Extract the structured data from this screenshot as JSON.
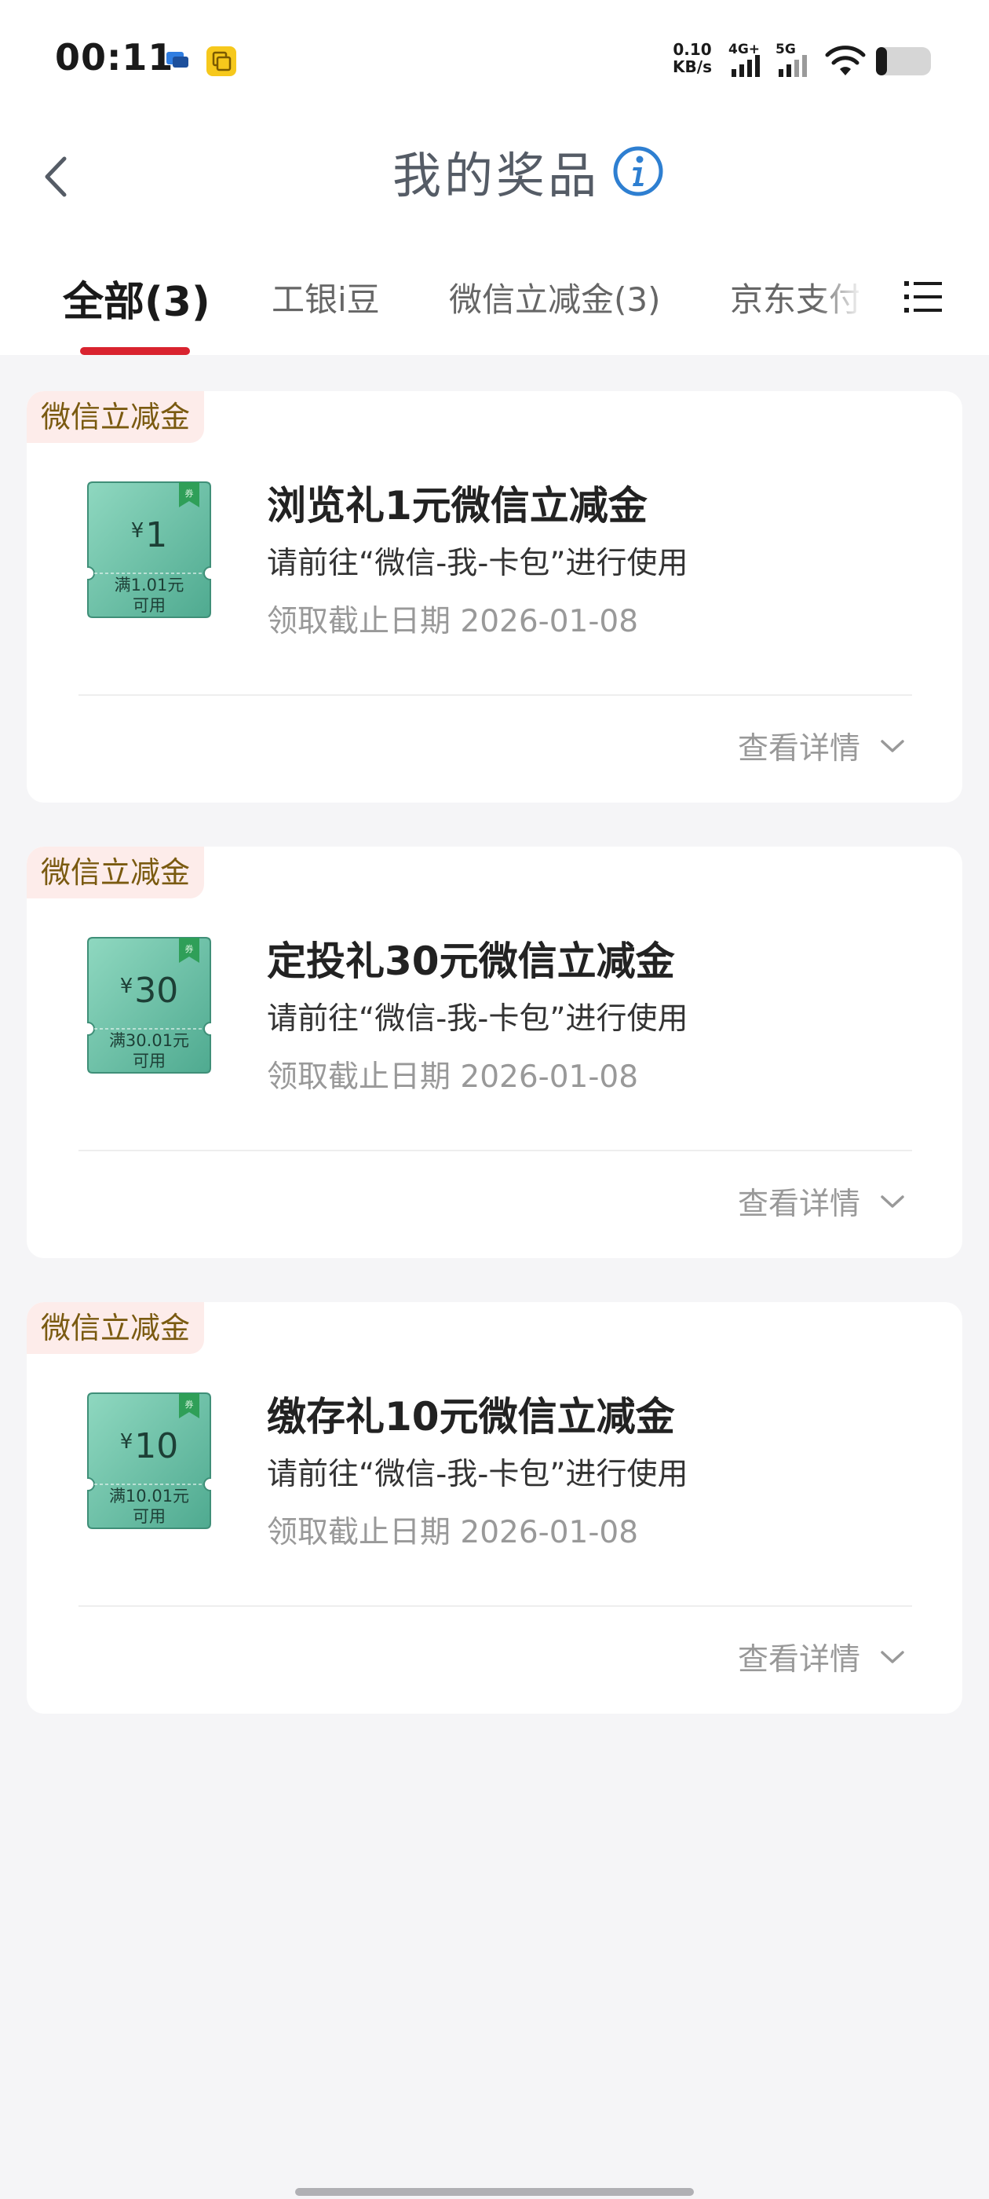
{
  "status_bar": {
    "time": "00:11",
    "net_speed_value": "0.10",
    "net_speed_unit": "KB/s",
    "network_1": "4G+",
    "network_2": "5G"
  },
  "header": {
    "title": "我的奖品"
  },
  "tabs": [
    {
      "label": "全部(3)",
      "active": true
    },
    {
      "label": "工银i豆",
      "active": false
    },
    {
      "label": "微信立减金(3)",
      "active": false
    },
    {
      "label": "京东支付",
      "active": false
    }
  ],
  "prizes": [
    {
      "tag": "微信立减金",
      "coupon_currency": "¥",
      "coupon_amount": "1",
      "coupon_condition_1": "满1.01元",
      "coupon_condition_2": "可用",
      "title": "浏览礼1元微信立减金",
      "desc": "请前往“微信-我-卡包”进行使用",
      "deadline": "领取截止日期 2026-01-08",
      "detail_label": "查看详情"
    },
    {
      "tag": "微信立减金",
      "coupon_currency": "¥",
      "coupon_amount": "30",
      "coupon_condition_1": "满30.01元",
      "coupon_condition_2": "可用",
      "title": "定投礼30元微信立减金",
      "desc": "请前往“微信-我-卡包”进行使用",
      "deadline": "领取截止日期 2026-01-08",
      "detail_label": "查看详情"
    },
    {
      "tag": "微信立减金",
      "coupon_currency": "¥",
      "coupon_amount": "10",
      "coupon_condition_1": "满10.01元",
      "coupon_condition_2": "可用",
      "title": "缴存礼10元微信立减金",
      "desc": "请前往“微信-我-卡包”进行使用",
      "deadline": "领取截止日期 2026-01-08",
      "detail_label": "查看详情"
    }
  ],
  "colors": {
    "accent_red": "#d9232f",
    "tag_bg": "#fdecea",
    "tag_text": "#7a5a10",
    "coupon_green": "#62bfa5",
    "info_blue": "#2e7fd1"
  },
  "icons": {
    "back": "chevron-left-icon",
    "info": "info-icon",
    "menu": "list-menu-icon",
    "expand": "chevron-down-icon",
    "coupon_badge": "bookmark-icon"
  }
}
